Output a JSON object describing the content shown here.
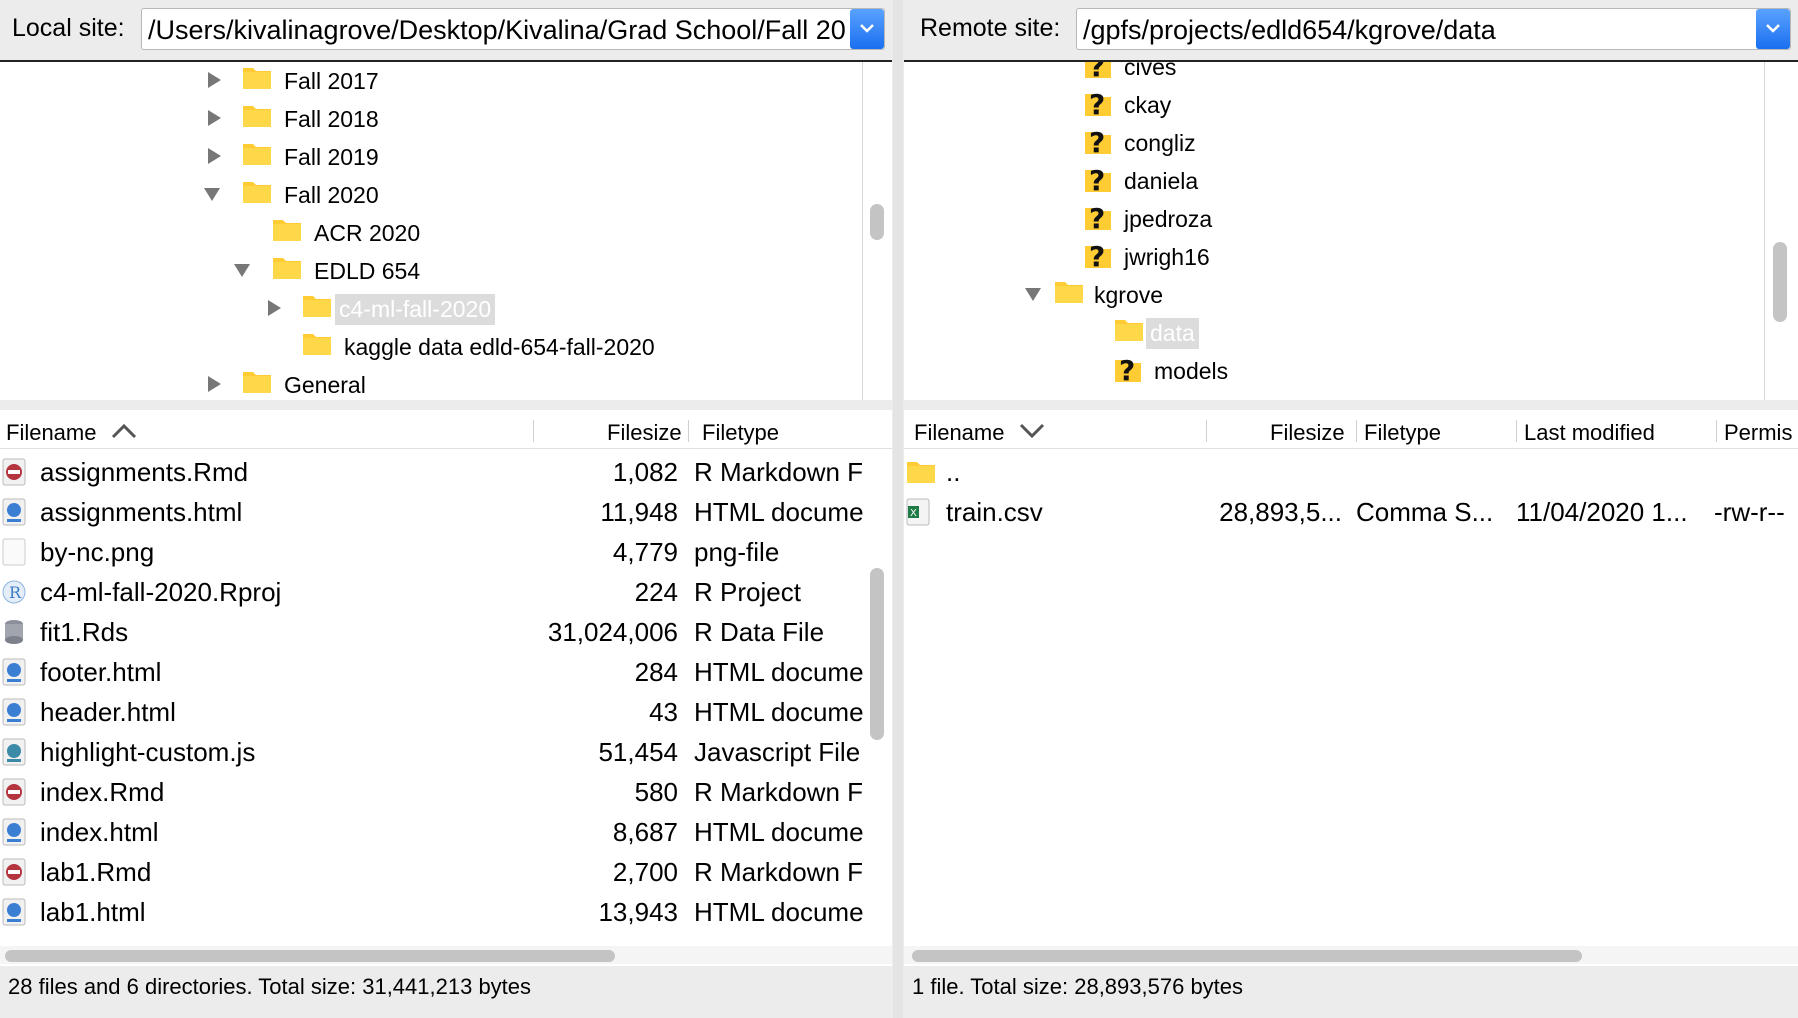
{
  "local": {
    "label": "Local site:",
    "path": "/Users/kivalinagrove/Desktop/Kivalina/Grad School/Fall 20",
    "tree": [
      {
        "name": "Fall 2017"
      },
      {
        "name": "Fall 2018"
      },
      {
        "name": "Fall 2019"
      },
      {
        "name": "Fall 2020"
      },
      {
        "name": "ACR 2020"
      },
      {
        "name": "EDLD 654"
      },
      {
        "name": "c4-ml-fall-2020"
      },
      {
        "name": "kaggle data edld-654-fall-2020"
      },
      {
        "name": "General"
      }
    ],
    "columns": {
      "filename": "Filename",
      "filesize": "Filesize",
      "filetype": "Filetype"
    },
    "files": [
      {
        "name": "assignments.Rmd",
        "size": "1,082",
        "type": "R Markdown F",
        "icon": "rmd-file-icon"
      },
      {
        "name": "assignments.html",
        "size": "11,948",
        "type": "HTML docume",
        "icon": "html-file-icon"
      },
      {
        "name": "by-nc.png",
        "size": "4,779",
        "type": "png-file",
        "icon": "png-file-icon"
      },
      {
        "name": "c4-ml-fall-2020.Rproj",
        "size": "224",
        "type": "R Project",
        "icon": "rproj-file-icon"
      },
      {
        "name": "fit1.Rds",
        "size": "31,024,006",
        "type": "R Data File",
        "icon": "rds-file-icon"
      },
      {
        "name": "footer.html",
        "size": "284",
        "type": "HTML docume",
        "icon": "html-file-icon"
      },
      {
        "name": "header.html",
        "size": "43",
        "type": "HTML docume",
        "icon": "html-file-icon"
      },
      {
        "name": "highlight-custom.js",
        "size": "51,454",
        "type": "Javascript File",
        "icon": "js-file-icon"
      },
      {
        "name": "index.Rmd",
        "size": "580",
        "type": "R Markdown F",
        "icon": "rmd-file-icon"
      },
      {
        "name": "index.html",
        "size": "8,687",
        "type": "HTML docume",
        "icon": "html-file-icon"
      },
      {
        "name": "lab1.Rmd",
        "size": "2,700",
        "type": "R Markdown F",
        "icon": "rmd-file-icon"
      },
      {
        "name": "lab1.html",
        "size": "13,943",
        "type": "HTML docume",
        "icon": "html-file-icon"
      }
    ],
    "status": "28 files and 6 directories. Total size: 31,441,213 bytes"
  },
  "remote": {
    "label": "Remote site:",
    "path": "/gpfs/projects/edld654/kgrove/data",
    "tree": [
      {
        "name": "cives"
      },
      {
        "name": "ckay"
      },
      {
        "name": "congliz"
      },
      {
        "name": "daniela"
      },
      {
        "name": "jpedroza"
      },
      {
        "name": "jwrigh16"
      },
      {
        "name": "kgrove"
      },
      {
        "name": "data"
      },
      {
        "name": "models"
      }
    ],
    "columns": {
      "filename": "Filename",
      "filesize": "Filesize",
      "filetype": "Filetype",
      "modified": "Last modified",
      "perms": "Permis"
    },
    "files": [
      {
        "name": "..",
        "size": "",
        "type": "",
        "modified": "",
        "perms": "",
        "icon": "folder-icon"
      },
      {
        "name": "train.csv",
        "size": "28,893,5...",
        "type": "Comma S...",
        "modified": "11/04/2020 1...",
        "perms": "-rw-r--",
        "icon": "csv-file-icon"
      }
    ],
    "status": "1 file. Total size: 28,893,576 bytes"
  }
}
